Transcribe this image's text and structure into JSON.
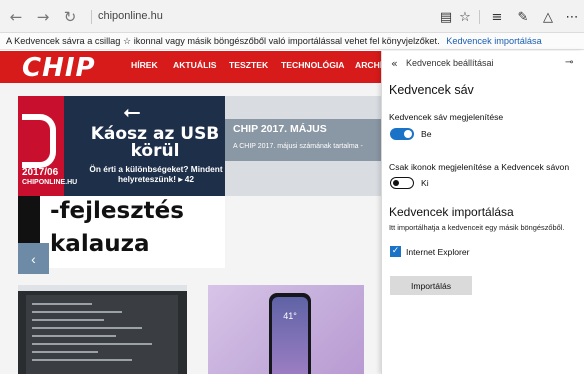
{
  "browser": {
    "url": "chiponline.hu",
    "nav_icons": {
      "back": "back-arrow-icon",
      "forward": "forward-arrow-icon",
      "refresh": "refresh-icon"
    },
    "toolbar_icons": [
      "reading-view-icon",
      "favorite-star-icon",
      "hub-icon",
      "web-note-icon",
      "share-icon",
      "more-icon"
    ]
  },
  "import_bar": {
    "message": "A Kedvencek sávra a csillag ☆ ikonnal vagy másik böngészőből való importálással vehet fel könyvjelzőket.",
    "link": "Kedvencek importálása"
  },
  "site": {
    "logo": "CHIP",
    "nav": [
      "HÍREK",
      "AKTUÁLIS",
      "TESZTEK",
      "TECHNOLÓGIA",
      "ARCHÍ"
    ],
    "feature": {
      "usb_symbol": "⭠",
      "headline": "Káosz az USB körül",
      "subline": "Ön érti a különbségeket? Mindent helyreteszünk! ▸ 42",
      "issue": "2017/06",
      "site": "CHIPONLINE.HU",
      "caption_title": "CHIP 2017. MÁJUS",
      "caption_text": "A CHIP 2017. májusi számának tartalma -"
    },
    "promo": {
      "line1": "-fejlesztés",
      "line2": "kalauza"
    },
    "slider_arrow": "‹",
    "phone_time": "41°"
  },
  "panel": {
    "back_icon": "«",
    "title": "Kedvencek beállításai",
    "pin_icon": "⊸",
    "section1": "Kedvencek sáv",
    "toggle1_label": "Kedvencek sáv megjelenítése",
    "toggle1_state": "Be",
    "toggle2_label": "Csak ikonok megjelenítése a Kedvencek sávon",
    "toggle2_state": "Ki",
    "section2": "Kedvencek importálása",
    "import_desc": "Itt importálhatja a kedvenceit egy másik böngészőből.",
    "checkbox_label": "Internet Explorer",
    "import_button": "Importálás"
  },
  "colors": {
    "accent": "#1a73c7",
    "brand_red": "#d71a1a"
  }
}
